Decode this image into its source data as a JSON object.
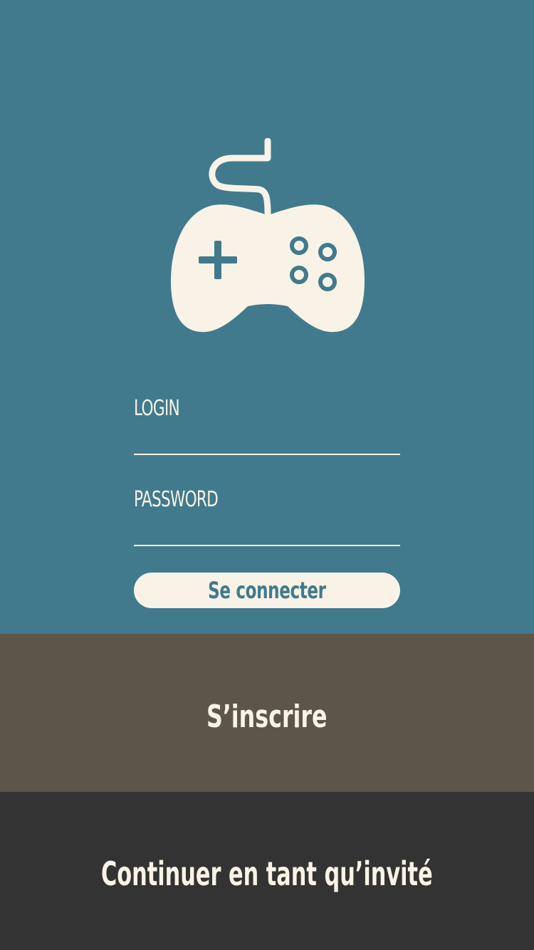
{
  "colors": {
    "primary": "#417a8d",
    "cream": "#f8f3e6",
    "signup_bg": "#5d554a",
    "guest_bg": "#333333"
  },
  "logo": {
    "icon": "gamepad-icon"
  },
  "form": {
    "login_label": "LOGIN",
    "login_value": "",
    "password_label": "PASSWORD",
    "password_value": "",
    "connect_label": "Se connecter"
  },
  "signup": {
    "label": "S’inscrire"
  },
  "guest": {
    "label": "Continuer en tant qu’invité"
  }
}
